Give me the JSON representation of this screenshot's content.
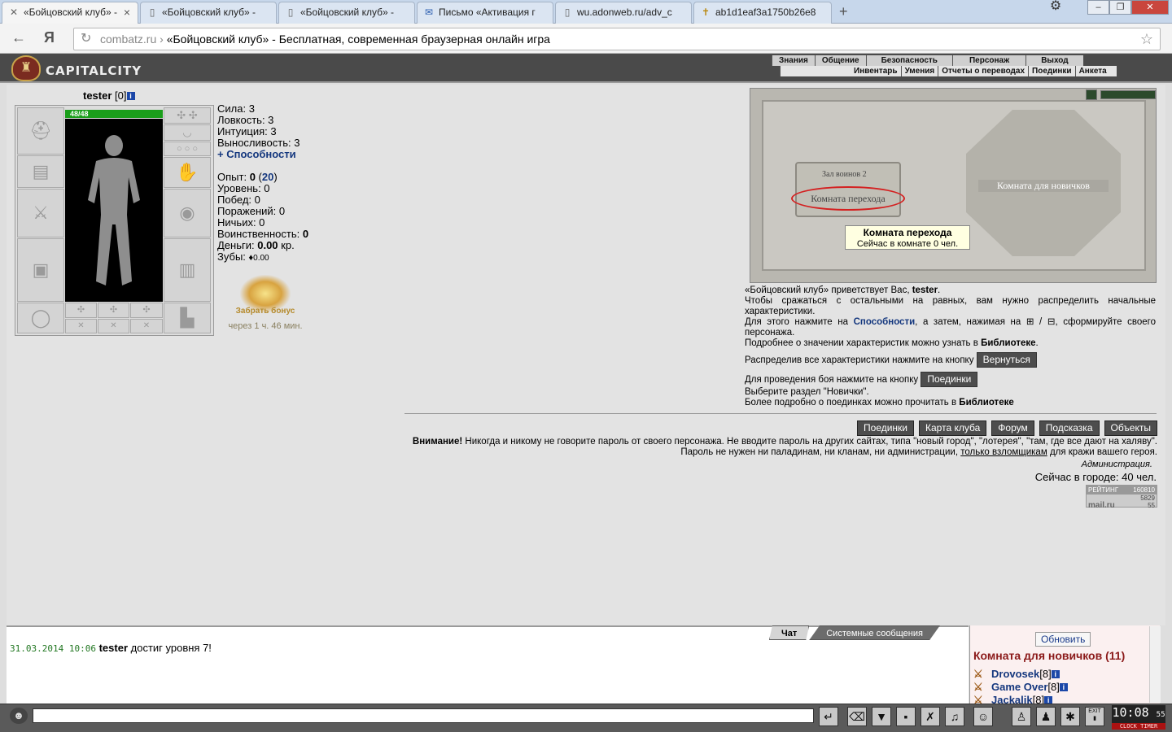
{
  "browser": {
    "tabs": [
      {
        "label": "«Бойцовский клуб» -",
        "icon": "swords-icon"
      },
      {
        "label": "«Бойцовский клуб» -",
        "icon": "page-icon"
      },
      {
        "label": "«Бойцовский клуб» -",
        "icon": "page-icon"
      },
      {
        "label": "Письмо «Активация г",
        "icon": "mail-icon"
      },
      {
        "label": "wu.adonweb.ru/adv_c",
        "icon": "page-icon"
      },
      {
        "label": "ab1d1eaf3a1750b26e8",
        "icon": "cross-icon"
      }
    ],
    "url_host": "combatz.ru",
    "url_title": "«Бойцовский клуб» - Бесплатная, современная браузерная онлайн игра"
  },
  "header": {
    "city": "CAPITALCITY",
    "menu_main": [
      "Знания",
      "Общение",
      "Безопасность",
      "Персонаж",
      "Выход"
    ],
    "menu_sub": [
      "Инвентарь",
      "Умения",
      "Отчеты о переводах",
      "Поединки",
      "Анкета"
    ]
  },
  "character": {
    "name": "tester",
    "level": "[0]",
    "hp": "48/48",
    "stats": [
      "Сила: 3",
      "Ловкость: 3",
      "Интуиция: 3",
      "Выносливость: 3"
    ],
    "abilities_link": "+ Способности",
    "exp_label": "Опыт:",
    "exp": "0",
    "exp_next": "20",
    "level_line": "Уровень: 0",
    "wins": "Побед: 0",
    "losses": "Поражений: 0",
    "draws": "Ничьих: 0",
    "war_label": "Воинственность:",
    "war": "0",
    "money_label": "Деньги:",
    "money": "0.00",
    "money_unit": "кр.",
    "teeth_label": "Зубы:",
    "teeth": "0.00"
  },
  "bonus": {
    "label": "Забрать бонус",
    "time": "через 1 ч. 46 мин."
  },
  "map": {
    "room_small": "Зал воинов 2",
    "room_transit": "Комната перехода",
    "room_newbies": "Комната для новичков",
    "tooltip_title": "Комната перехода",
    "tooltip_text": "Сейчас в комнате 0 чел."
  },
  "welcome": {
    "l1a": "«Бойцовский клуб» приветствует Вас,",
    "l1b": "tester",
    "l2": "Чтобы сражаться с остальными на равных, вам нужно распределить начальные характеристики.",
    "l3a": "Для этого нажмите на",
    "l3b": "Способности",
    "l3c": ", а затем, нажимая на ⊞ / ⊟, сформируйте своего персонажа.",
    "l4a": "Подробнее о значении характеристик можно узнать в",
    "l4b": "Библиотеке",
    "l5": "Распределив все характеристики нажмите на кнопку",
    "btn_return": "Вернуться",
    "l6": "Для проведения боя нажмите на кнопку",
    "btn_fights": "Поединки",
    "l7": "Выберите раздел \"Новички\".",
    "l8a": "Более подробно о поединках можно прочитать в",
    "l8b": "Библиотеке"
  },
  "buttons": [
    "Поединки",
    "Карта клуба",
    "Форум",
    "Подсказка",
    "Объекты"
  ],
  "warning": {
    "bold": "Внимание!",
    "text1": "Никогда и никому не говорите пароль от своего персонажа. Не вводите пароль на других сайтах, типа \"новый город\", \"лотерея\", \"там, где все дают на халяву\". Пароль не нужен ни паладинам, ни кланам, ни администрации,",
    "link": "только взломщикам",
    "text2": "для кражи вашего героя.",
    "sign": "Администрация."
  },
  "online": "Сейчас в городе: 40 чел.",
  "counter": {
    "title": "РЕЙТИНГ",
    "v1": "160810",
    "v2": "5829",
    "v3": "55",
    "brand": "mail.ru"
  },
  "chat": {
    "tabs": [
      "Чат",
      "Системные сообщения"
    ],
    "timestamp": "31.03.2014 10:06",
    "user": "tester",
    "message": "достиг уровня 7!"
  },
  "room": {
    "refresh": "Обновить",
    "title": "Комната для новичков (11)",
    "players": [
      {
        "name": "Drovosek",
        "lvl": "[8]"
      },
      {
        "name": "Game Over",
        "lvl": "[8]"
      },
      {
        "name": "Jackalik",
        "lvl": "[8]"
      }
    ]
  },
  "clock": {
    "time": "10:08",
    "sec": "55",
    "label": "CLOCK TIMER",
    "exit": "EXIT"
  }
}
